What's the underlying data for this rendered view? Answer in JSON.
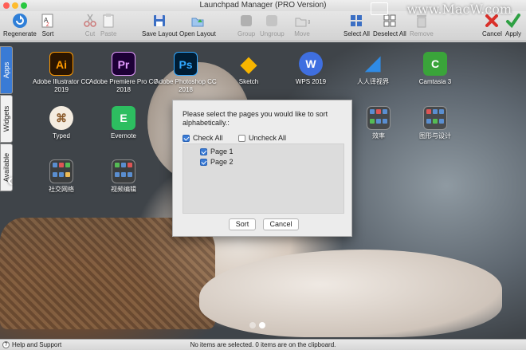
{
  "window": {
    "title": "Launchpad Manager (PRO Version)"
  },
  "watermark": "www.MacW.com",
  "toolbar": {
    "regenerate": "Regenerate",
    "sort": "Sort",
    "cut": "Cut",
    "paste": "Paste",
    "save_layout": "Save Layout",
    "open_layout": "Open Layout",
    "group": "Group",
    "ungroup": "Ungroup",
    "move": "Move",
    "select_all": "Select All",
    "deselect_all": "Deselect All",
    "remove": "Remove",
    "cancel": "Cancel",
    "apply": "Apply"
  },
  "side_tabs": [
    "Apps",
    "Widgets",
    "Available"
  ],
  "apps": [
    {
      "label": "Adobe Illustrator CC 2019",
      "icon": "illustrator-icon",
      "glyph": "Ai",
      "color": "#2b1500",
      "fg": "#ff9a00"
    },
    {
      "label": "Adobe Premiere Pro CC 2018",
      "icon": "premiere-icon",
      "glyph": "Pr",
      "color": "#1d0036",
      "fg": "#e49bff"
    },
    {
      "label": "Adobe Photoshop CC 2018",
      "icon": "photoshop-icon",
      "glyph": "Ps",
      "color": "#001d34",
      "fg": "#31a8ff"
    },
    {
      "label": "Sketch",
      "icon": "sketch-icon",
      "glyph": "◆",
      "color": "rgba(0,0,0,0)",
      "fg": "#f7b500"
    },
    {
      "label": "WPS 2019",
      "icon": "wps-icon",
      "glyph": "W",
      "color": "#3f6fe0",
      "fg": "#ffffff"
    },
    {
      "label": "人人译视界",
      "icon": "translator-icon",
      "glyph": "◢",
      "color": "rgba(0,0,0,0)",
      "fg": "#2f8be6"
    },
    {
      "label": "Camtasia 3",
      "icon": "camtasia-icon",
      "glyph": "C",
      "color": "#3aa43a",
      "fg": "#ffffff"
    },
    {
      "label": "Typed",
      "icon": "typed-icon",
      "glyph": "⌘",
      "color": "#f4ece0",
      "fg": "#8a5a2b"
    },
    {
      "label": "Evernote",
      "icon": "evernote-icon",
      "glyph": "E",
      "color": "#2dbe60",
      "fg": "#ffffff"
    },
    {
      "label": "效率",
      "icon": "folder-icon",
      "glyph": "",
      "color": "",
      "fg": ""
    },
    {
      "label": "图形与设计",
      "icon": "folder-icon",
      "glyph": "",
      "color": "",
      "fg": ""
    },
    {
      "label": "社交网络",
      "icon": "folder-icon",
      "glyph": "",
      "color": "",
      "fg": ""
    },
    {
      "label": "视频编辑",
      "icon": "folder-icon",
      "glyph": "",
      "color": "",
      "fg": ""
    }
  ],
  "dialog": {
    "message": "Please select the pages you would like to sort alphabetically.:",
    "check_all": "Check All",
    "uncheck_all": "Uncheck All",
    "pages": [
      {
        "label": "Page 1",
        "checked": true
      },
      {
        "label": "Page 2",
        "checked": true
      }
    ],
    "sort_button": "Sort",
    "cancel_button": "Cancel"
  },
  "pagination": {
    "total": 2,
    "current": 2
  },
  "status": {
    "help": "Help and Support",
    "message": "No items are selected. 0 items are on the clipboard."
  },
  "colors": {
    "accent": "#3a7bd5",
    "cancel_red": "#d9312b",
    "apply_green": "#2ea043"
  }
}
